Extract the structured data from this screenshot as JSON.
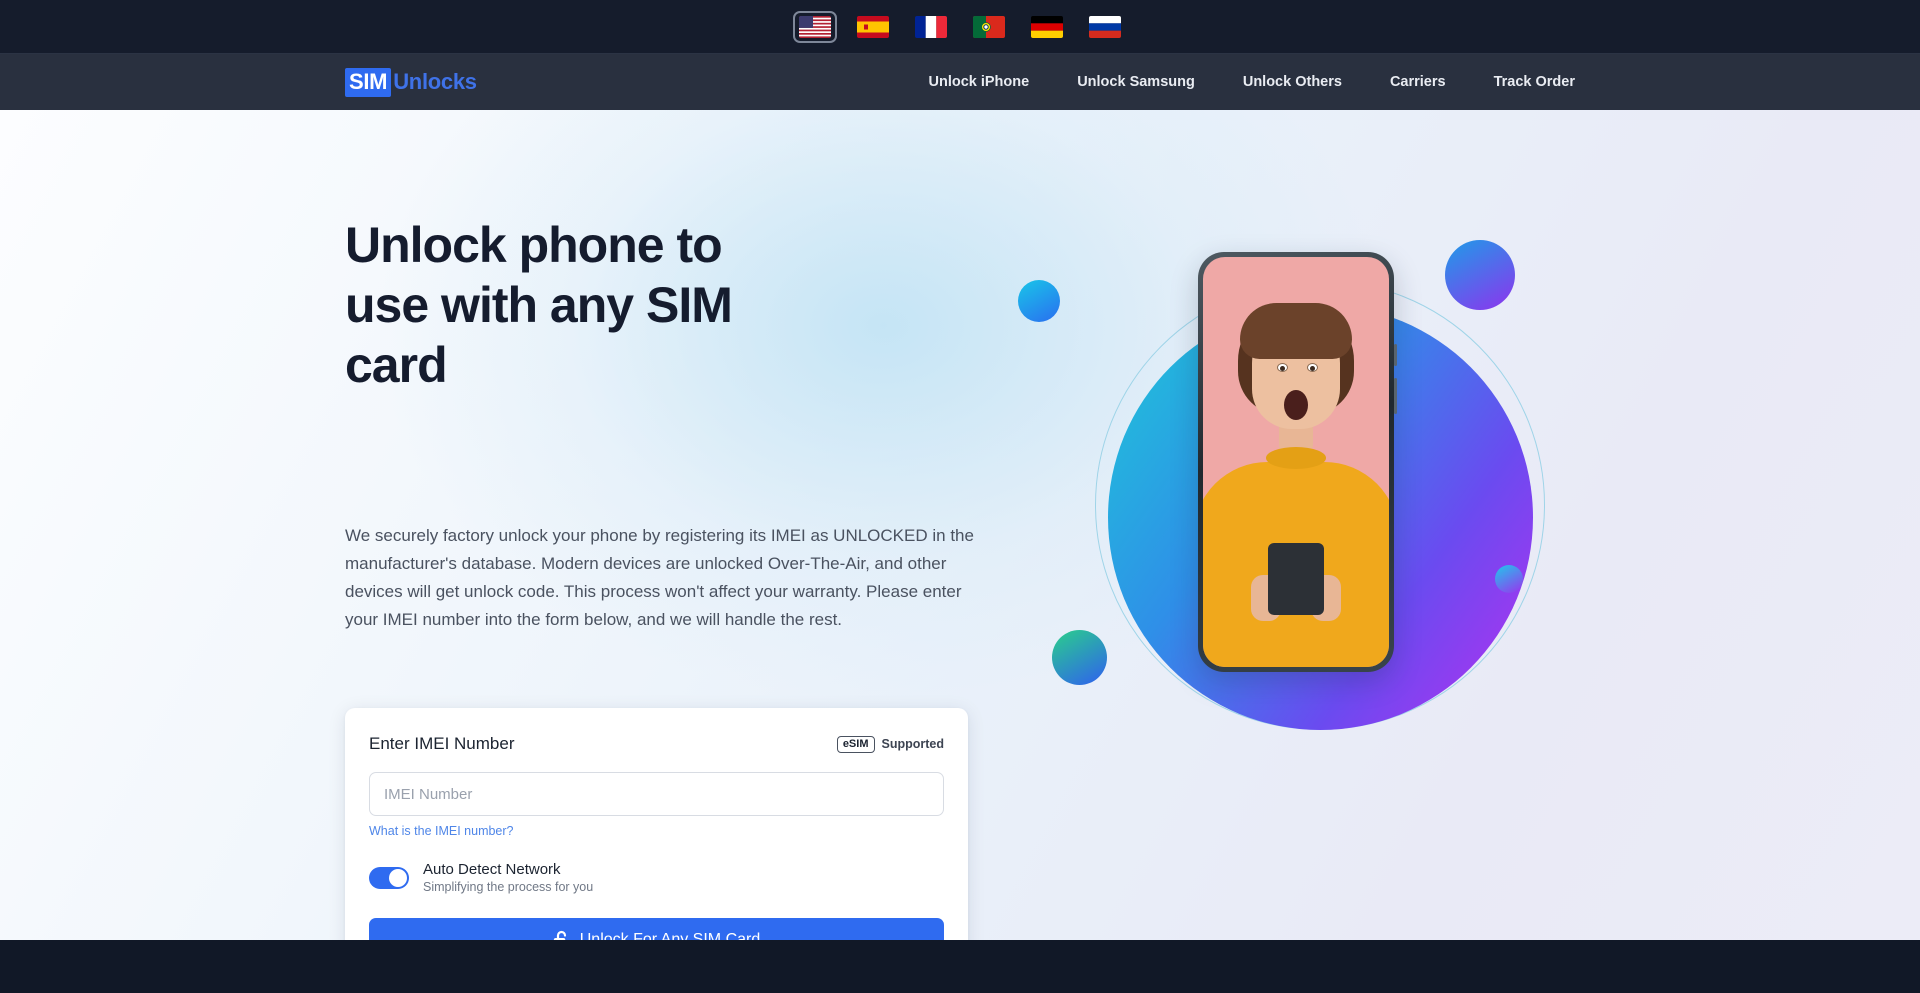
{
  "language_bar": {
    "languages": [
      {
        "name": "english",
        "flag": "us-flag-icon",
        "selected": true
      },
      {
        "name": "spanish",
        "flag": "spain-flag-icon",
        "selected": false
      },
      {
        "name": "french",
        "flag": "france-flag-icon",
        "selected": false
      },
      {
        "name": "portuguese",
        "flag": "portugal-flag-icon",
        "selected": false
      },
      {
        "name": "german",
        "flag": "germany-flag-icon",
        "selected": false
      },
      {
        "name": "russian",
        "flag": "russia-flag-icon",
        "selected": false
      }
    ]
  },
  "header": {
    "logo": {
      "badge": "SIM",
      "word": "Unlocks"
    },
    "nav": [
      {
        "label": "Unlock iPhone"
      },
      {
        "label": "Unlock Samsung"
      },
      {
        "label": "Unlock Others"
      },
      {
        "label": "Carriers"
      },
      {
        "label": "Track Order"
      }
    ]
  },
  "hero": {
    "headline": "Unlock phone to use with any SIM card",
    "paragraph": "We securely factory unlock your phone by registering its IMEI as UNLOCKED in the manufacturer's database. Modern devices are unlocked Over-The-Air, and other devices will get unlock code. This process won't affect your warranty. Please enter your IMEI number into the form below, and we will handle the rest."
  },
  "form": {
    "title": "Enter IMEI Number",
    "esim_badge": "eSIM",
    "esim_supported": "Supported",
    "imei_value": "",
    "imei_placeholder": "IMEI Number",
    "help_link": "What is the IMEI number?",
    "toggle": {
      "label": "Auto Detect Network",
      "sublabel": "Simplifying the process for you",
      "enabled": true
    },
    "submit_label": "Unlock For Any SIM Card",
    "submit_icon": "open-padlock-icon"
  },
  "colors": {
    "accent_blue": "#2f6bf0",
    "link_blue": "#4f86e8",
    "nav_bg": "#29303f",
    "lang_bar_bg": "#151c2c",
    "footer_bg": "#111827",
    "headline": "#151c2e"
  }
}
